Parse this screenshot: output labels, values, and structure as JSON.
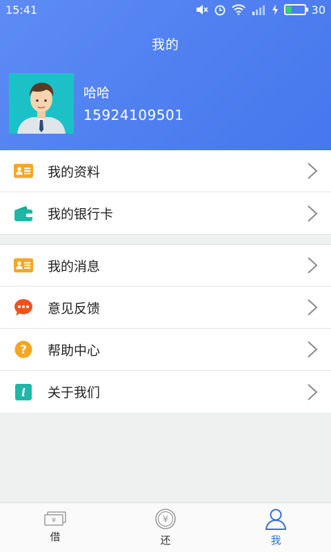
{
  "status_bar": {
    "time": "15:41",
    "battery_level": "30"
  },
  "header": {
    "title": "我的"
  },
  "user": {
    "name": "哈哈",
    "phone": "15924109501"
  },
  "menu_group_1": [
    {
      "label": "我的资料",
      "icon": "id-card-icon"
    },
    {
      "label": "我的银行卡",
      "icon": "wallet-icon"
    }
  ],
  "menu_group_2": [
    {
      "label": "我的消息",
      "icon": "id-card-icon"
    },
    {
      "label": "意见反馈",
      "icon": "chat-bubble-icon"
    },
    {
      "label": "帮助中心",
      "icon": "question-icon"
    },
    {
      "label": "关于我们",
      "icon": "info-icon"
    }
  ],
  "tabs": [
    {
      "label": "借",
      "icon": "money-icon"
    },
    {
      "label": "还",
      "icon": "yuan-coin-icon"
    },
    {
      "label": "我",
      "icon": "person-icon",
      "active": true
    }
  ],
  "colors": {
    "accent": "#4f7ff0",
    "active_tab": "#2f6fd6",
    "orange": "#f5a623",
    "teal": "#1fb7a6"
  }
}
